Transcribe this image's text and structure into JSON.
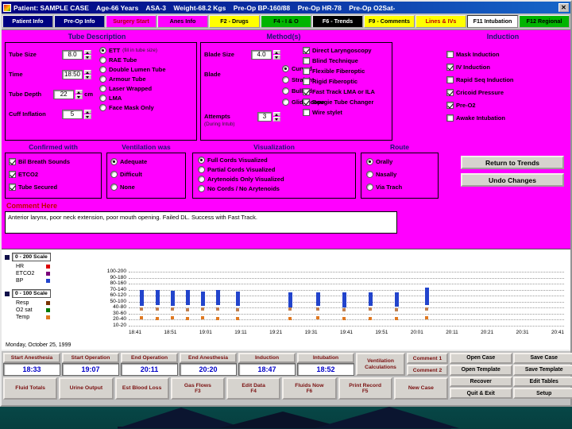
{
  "colors": {
    "form_background": "#ff00ff",
    "titlebar_blue": "#000080",
    "tab_yellow": "#ffff00",
    "tab_green": "#00b400",
    "time_value_blue": "#0000c8",
    "comment_label_red": "#c00000",
    "bp_bar_blue": "#2244cc",
    "hr_square_tan": "#c08050",
    "temp_square_orange": "#e07820"
  },
  "titlebar": {
    "title": "Patient: SAMPLE CASE    Age-66 Years    ASA-3    Weight-68.2 Kgs    Pre-Op BP-160/88    Pre-Op HR-78    Pre-Op O2Sat-",
    "close_glyph": "✕"
  },
  "tabs": [
    {
      "label": "Patient Info"
    },
    {
      "label": "Pre-Op Info"
    },
    {
      "label": "Surgery Start"
    },
    {
      "label": "Anes Info"
    },
    {
      "label": "F2 - Drugs"
    },
    {
      "label": "F4 - I & O"
    },
    {
      "label": "F6 - Trends"
    },
    {
      "label": "F9 - Comments"
    },
    {
      "label": "Lines & IVs"
    },
    {
      "label": "F11 Intubation"
    },
    {
      "label": "F12 Regional"
    }
  ],
  "tube": {
    "header": "Tube Description",
    "fields": [
      {
        "label": "Tube Size",
        "value": "8.0"
      },
      {
        "label": "Time",
        "value": "18:50"
      },
      {
        "label": "Tube Depth",
        "value": "22",
        "suffix": "cm"
      },
      {
        "label": "Cuff Inflation",
        "value": "5"
      }
    ],
    "options": [
      {
        "label": "ETT",
        "note": "(fill in tube size)",
        "checked": true
      },
      {
        "label": "RAE Tube",
        "checked": false
      },
      {
        "label": "Double Lumen Tube",
        "checked": false
      },
      {
        "label": "Armour Tube",
        "checked": false
      },
      {
        "label": "Laser Wrapped",
        "checked": false
      },
      {
        "label": "LMA",
        "checked": false
      },
      {
        "label": "Face Mask Only",
        "checked": false
      }
    ]
  },
  "methods": {
    "header": "Method(s)",
    "blade_size": {
      "label": "Blade Size",
      "value": "4.0"
    },
    "blade_label": "Blade",
    "blade_options": [
      {
        "label": "Curved",
        "checked": true
      },
      {
        "label": "Straight",
        "checked": false
      },
      {
        "label": "Bullard",
        "checked": false
      },
      {
        "label": "GlideScope",
        "checked": false
      }
    ],
    "attempts": {
      "label": "Attempts",
      "note": "(During Intub)",
      "value": "3"
    },
    "checks": [
      {
        "label": "Direct Laryngoscopy",
        "checked": true
      },
      {
        "label": "Blind Technique",
        "checked": false
      },
      {
        "label": "Flexible Fiberoptic",
        "checked": false
      },
      {
        "label": "Rigid Fiberoptic",
        "checked": false
      },
      {
        "label": "Fast Track LMA or ILA",
        "checked": true
      },
      {
        "label": "Bougie Tube Changer",
        "checked": true
      },
      {
        "label": "Wire stylet",
        "checked": false
      }
    ]
  },
  "induction": {
    "header": "Induction",
    "checks": [
      {
        "label": "Mask Induction",
        "checked": false
      },
      {
        "label": "IV Induction",
        "checked": true
      },
      {
        "label": "Rapid Seq Induction",
        "checked": false
      },
      {
        "label": "Cricoid Pressure",
        "checked": true
      },
      {
        "label": "Pre-O2",
        "checked": true
      },
      {
        "label": "Awake Intubation",
        "checked": false
      }
    ]
  },
  "confirmed": {
    "header": "Confirmed with",
    "checks": [
      {
        "label": "Bil Breath Sounds",
        "checked": true
      },
      {
        "label": "ETCO2",
        "checked": true
      },
      {
        "label": "Tube Secured",
        "checked": true
      }
    ]
  },
  "ventilation": {
    "header": "Ventilation  was",
    "options": [
      {
        "label": "Adequate",
        "checked": true
      },
      {
        "label": "Difficult",
        "checked": false
      },
      {
        "label": "None",
        "checked": false
      }
    ]
  },
  "visualization": {
    "header": "Visualization",
    "options": [
      {
        "label": "Full Cords Visualized",
        "checked": true
      },
      {
        "label": "Partial Cords Visualized",
        "checked": false
      },
      {
        "label": "Arytenoids Only Visualized",
        "checked": false
      },
      {
        "label": "No Cords / No Arytenoids",
        "checked": false
      }
    ]
  },
  "route": {
    "header": "Route",
    "options": [
      {
        "label": "Orally",
        "checked": true
      },
      {
        "label": "Nasally",
        "checked": false
      },
      {
        "label": "Via Trach",
        "checked": false
      }
    ]
  },
  "actions": {
    "return_to_trends": "Return to Trends",
    "undo_changes": "Undo Changes"
  },
  "comment": {
    "label": "Comment Here",
    "text": "Anterior larynx, poor neck extension, poor mouth opening. Failed DL. Success with Fast Track."
  },
  "chart_data": {
    "type": "mixed",
    "date_label": "Monday, October 25, 1999",
    "scale_200_label": "0 - 200 Scale",
    "scale_100_label": "0 - 100 Scale",
    "legend_200": [
      {
        "label": "HR",
        "color": "#dd0000"
      },
      {
        "label": "ETCO2",
        "color": "#7a007a"
      },
      {
        "label": "BP",
        "color": "#2244cc"
      }
    ],
    "legend_100": [
      {
        "label": "Resp",
        "color": "#7a3300"
      },
      {
        "label": "O2 sat",
        "color": "#007a00"
      },
      {
        "label": "Temp",
        "color": "#e07820"
      }
    ],
    "y_rows": [
      "100-200",
      "90-180",
      "80-160",
      "70-140",
      "60-120",
      "50-100",
      "40-80",
      "30-60",
      "20-40",
      "10-20"
    ],
    "x_labels": [
      "18:41",
      "18:51",
      "19:01",
      "19:11",
      "19:21",
      "19:31",
      "19:41",
      "19:51",
      "20:01",
      "20:11",
      "20:21",
      "20:31",
      "20:41"
    ],
    "series": [
      {
        "name": "BP",
        "type": "rangebar",
        "color": "#2244cc",
        "points": [
          {
            "fx": 0.03,
            "high": 138,
            "low": 86
          },
          {
            "fx": 0.065,
            "high": 140,
            "low": 88
          },
          {
            "fx": 0.1,
            "high": 136,
            "low": 85
          },
          {
            "fx": 0.135,
            "high": 138,
            "low": 88
          },
          {
            "fx": 0.17,
            "high": 135,
            "low": 85
          },
          {
            "fx": 0.205,
            "high": 138,
            "low": 88
          },
          {
            "fx": 0.25,
            "high": 135,
            "low": 85
          },
          {
            "fx": 0.37,
            "high": 130,
            "low": 82
          },
          {
            "fx": 0.435,
            "high": 132,
            "low": 85
          },
          {
            "fx": 0.495,
            "high": 130,
            "low": 82
          },
          {
            "fx": 0.555,
            "high": 132,
            "low": 85
          },
          {
            "fx": 0.615,
            "high": 130,
            "low": 84
          },
          {
            "fx": 0.685,
            "high": 148,
            "low": 88
          }
        ]
      },
      {
        "name": "HR",
        "type": "square",
        "color": "#c08050",
        "points": [
          {
            "fx": 0.03,
            "v": 76
          },
          {
            "fx": 0.065,
            "v": 75
          },
          {
            "fx": 0.1,
            "v": 76
          },
          {
            "fx": 0.135,
            "v": 74
          },
          {
            "fx": 0.17,
            "v": 76
          },
          {
            "fx": 0.205,
            "v": 75
          },
          {
            "fx": 0.25,
            "v": 74
          },
          {
            "fx": 0.37,
            "v": 75
          },
          {
            "fx": 0.435,
            "v": 76
          },
          {
            "fx": 0.495,
            "v": 74
          },
          {
            "fx": 0.555,
            "v": 75
          },
          {
            "fx": 0.615,
            "v": 74
          },
          {
            "fx": 0.685,
            "v": 76
          }
        ]
      },
      {
        "name": "Temp",
        "type": "square",
        "color": "#e07820",
        "points": [
          {
            "fx": 0.03,
            "v": 46
          },
          {
            "fx": 0.065,
            "v": 45
          },
          {
            "fx": 0.1,
            "v": 46
          },
          {
            "fx": 0.135,
            "v": 44
          },
          {
            "fx": 0.17,
            "v": 46
          },
          {
            "fx": 0.205,
            "v": 45
          },
          {
            "fx": 0.25,
            "v": 44
          },
          {
            "fx": 0.37,
            "v": 45
          },
          {
            "fx": 0.435,
            "v": 46
          },
          {
            "fx": 0.495,
            "v": 44
          },
          {
            "fx": 0.555,
            "v": 45
          },
          {
            "fx": 0.615,
            "v": 44
          },
          {
            "fx": 0.685,
            "v": 46
          }
        ]
      }
    ]
  },
  "bottom": {
    "time_fields": [
      {
        "label": "Start Anesthesia",
        "value": "18:33"
      },
      {
        "label": "Start Operation",
        "value": "19:07"
      },
      {
        "label": "End Operation",
        "value": "20:11"
      },
      {
        "label": "End Anesthesia",
        "value": "20:20"
      },
      {
        "label": "Induction",
        "value": "18:47"
      },
      {
        "label": "Intubation",
        "value": "18:52"
      }
    ],
    "vent_calc": "Ventilation Calculations",
    "comment1": "Comment 1",
    "comment2": "Comment 2",
    "row2": [
      {
        "label": "Fluid Totals"
      },
      {
        "label": "Urine Output"
      },
      {
        "label": "Est Blood Loss"
      },
      {
        "label": "Gas Flows",
        "key": "F3"
      },
      {
        "label": "Edit Data",
        "key": "F4"
      },
      {
        "label": "Fluids Now",
        "key": "F6"
      },
      {
        "label": "Print Record",
        "key": "F5"
      },
      {
        "label": "New Case"
      }
    ],
    "right_buttons": [
      "Open Case",
      "Save Case",
      "Open Template",
      "Save Template",
      "Recover",
      "Edit Tables",
      "Quit & Exit",
      "Setup"
    ]
  }
}
